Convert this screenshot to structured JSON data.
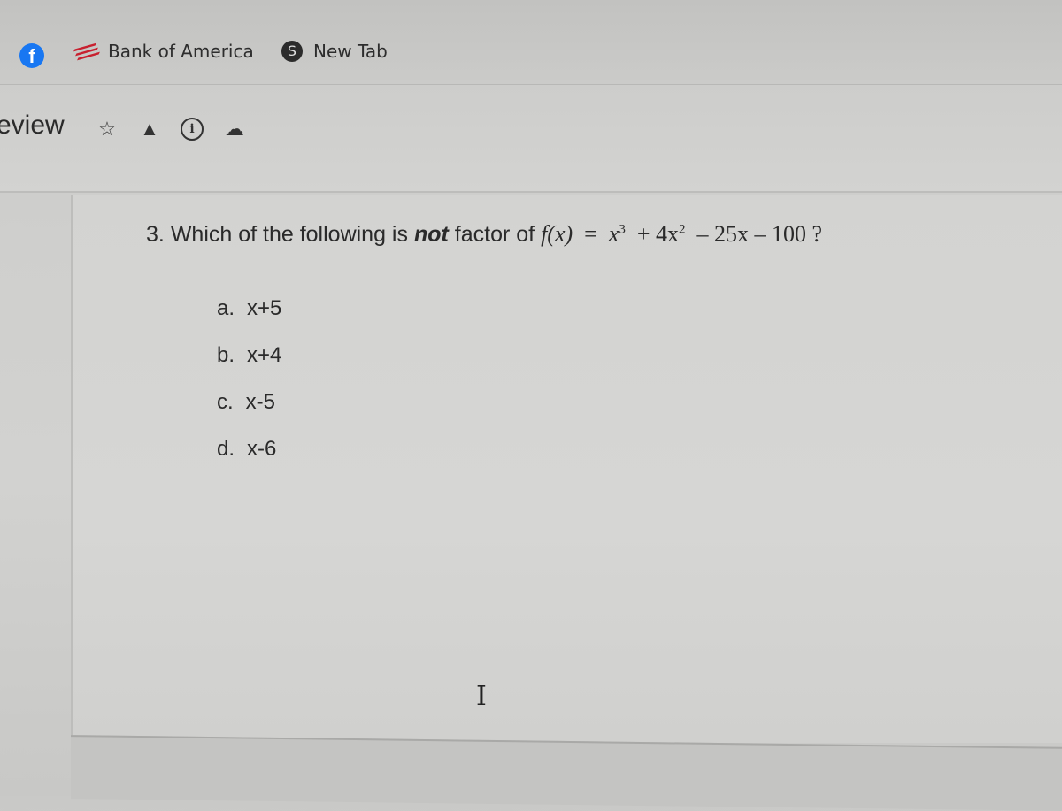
{
  "bookmarks": [
    {
      "icon": "facebook-icon",
      "label": ""
    },
    {
      "icon": "bank-of-america-icon",
      "label": "Bank of America"
    },
    {
      "icon": "globe-icon",
      "label": "New Tab"
    }
  ],
  "document": {
    "title_partial": "eview",
    "icons": [
      "star-icon",
      "drive-add-icon",
      "info-icon",
      "cloud-check-icon"
    ]
  },
  "question": {
    "number": "3.",
    "prefix": "Which of the following is",
    "emphasis": "not",
    "suffix": "factor of",
    "function": "f(x)",
    "equals": "=",
    "expression_terms": [
      "x",
      "3",
      "+ 4x",
      "2",
      "– 25x – 100 ?"
    ],
    "options": [
      {
        "letter": "a.",
        "text": "x+5"
      },
      {
        "letter": "b.",
        "text": "x+4"
      },
      {
        "letter": "c.",
        "text": "x-5"
      },
      {
        "letter": "d.",
        "text": "x-6"
      }
    ]
  },
  "cursor": "I"
}
